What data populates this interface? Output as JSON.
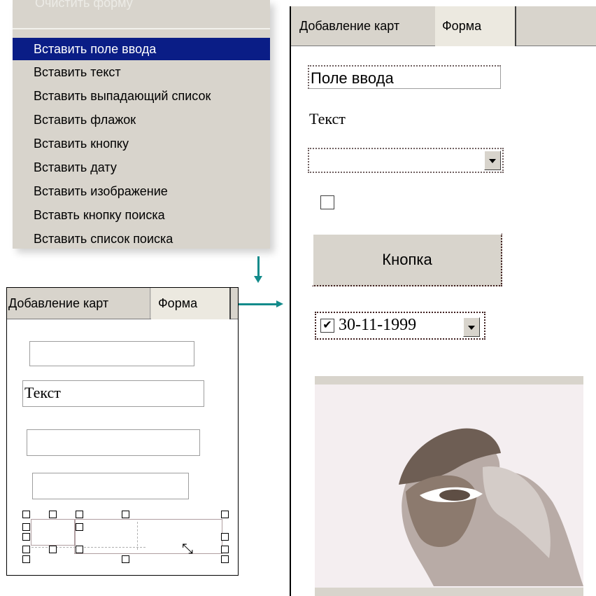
{
  "menu": {
    "top_item": "Очистить форму",
    "items": [
      "Вставить поле ввода",
      "Вставить текст",
      "Вставить выпадающий список",
      "Вставить флажок",
      "Вставить кнопку",
      "Вставить дату",
      "Вставить изображение",
      "Вставть кнопку поиска",
      "Вставить список поиска"
    ],
    "selected_index": 0
  },
  "designer": {
    "tabs": [
      "Добавление карт",
      "Форма"
    ],
    "active_tab": "Форма",
    "text_label": "Текст"
  },
  "form": {
    "tabs": [
      "Добавление карт",
      "Форма"
    ],
    "active_tab": "Форма",
    "input_value": "Поле ввода",
    "text_label": "Текст",
    "select_value": "",
    "checkbox_checked": false,
    "button_label": "Кнопка",
    "date_checked": true,
    "date_value": "30-11-1999"
  },
  "colors": {
    "selection": "#0a1d86",
    "arrow": "#138b8b",
    "panel_bg": "#d8d4cc"
  }
}
